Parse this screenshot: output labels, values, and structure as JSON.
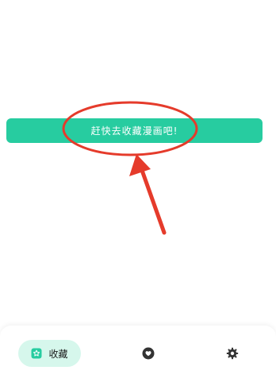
{
  "cta": {
    "label": "赶快去收藏漫画吧!"
  },
  "annotation": {
    "highlight_color": "#e53b2b",
    "arrow_icon": "red-arrow-icon",
    "circle_icon": "red-ellipse-highlight"
  },
  "bottom_nav": {
    "items": [
      {
        "label": "收藏",
        "icon": "collection-icon",
        "active": true
      },
      {
        "label": "",
        "icon": "heart-icon",
        "active": false
      },
      {
        "label": "",
        "icon": "gear-icon",
        "active": false
      }
    ]
  },
  "colors": {
    "accent": "#27cca0",
    "active_tab_bg": "#d6f7ec",
    "icon_dark": "#333333"
  }
}
